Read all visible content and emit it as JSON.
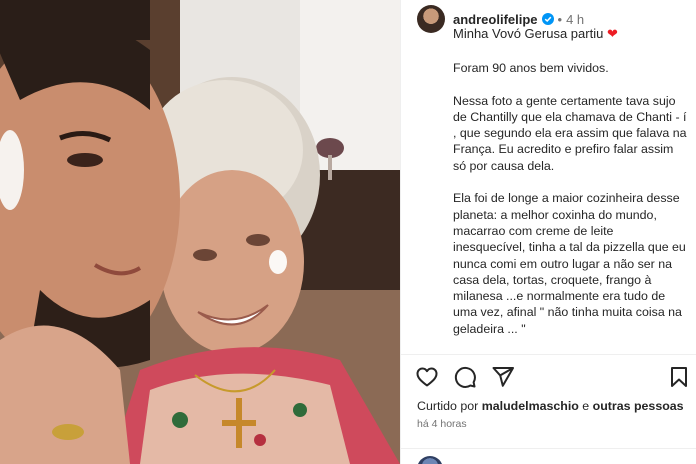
{
  "post": {
    "username": "andreolifelipe",
    "time": "4 h",
    "caption_first_line": "Minha Vovó Gerusa partiu",
    "caption_paragraphs": [
      "Foram 90 anos bem vividos.",
      "Nessa foto a gente certamente tava sujo de Chantilly que ela chamava de Chanti - í , que segundo ela era assim que falava na França. Eu acredito e prefiro falar assim só por causa dela.",
      "Ela foi de longe a maior cozinheira desse planeta: a melhor coxinha do mundo, macarrao com creme de leite inesquecível, tinha a tal da pizzella que eu nunca comi em outro lugar a não ser na casa dela, tortas, croquete, frango à milanesa ...e normalmente era tudo de uma vez, afinal \" não tinha muita coisa na geladeira ... \""
    ],
    "likes": {
      "prefix": "Curtido por",
      "user": "maludelmaschio",
      "conjunction": "e",
      "others": "outras pessoas"
    },
    "posted_ago": "há 4 horas"
  },
  "icons": {
    "verified": "verified-badge-icon",
    "heart_emoji": "red-heart-emoji",
    "like": "heart-outline-icon",
    "comment": "comment-bubble-icon",
    "share": "paper-plane-icon",
    "save": "bookmark-icon"
  },
  "colors": {
    "verified_blue": "#0095f6",
    "heart_red": "#ed1c24",
    "text": "#262626",
    "muted": "#737373"
  }
}
